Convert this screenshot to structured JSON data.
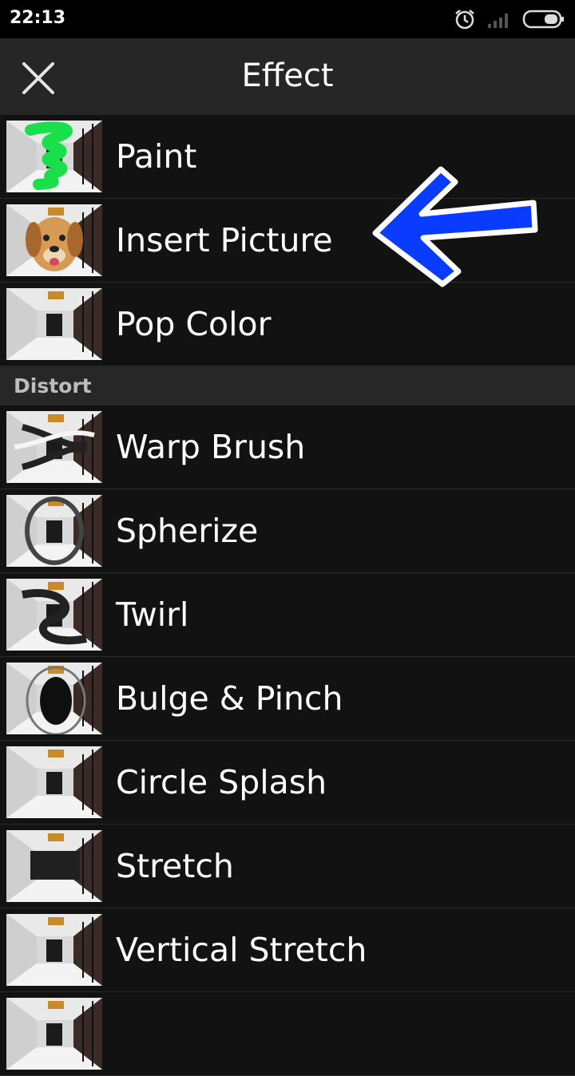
{
  "status_bar": {
    "time": "22:13",
    "icons": [
      "alarm-icon",
      "signal-icon",
      "battery-icon"
    ]
  },
  "app_bar": {
    "title": "Effect",
    "close_icon": "close-icon"
  },
  "effects": [
    {
      "label": "Paint",
      "thumb": "paint"
    },
    {
      "label": "Insert Picture",
      "thumb": "dog"
    },
    {
      "label": "Pop Color",
      "thumb": "hall"
    }
  ],
  "distort_section": {
    "header": "Distort",
    "items": [
      {
        "label": "Warp Brush",
        "thumb": "warp"
      },
      {
        "label": "Spherize",
        "thumb": "sphere"
      },
      {
        "label": "Twirl",
        "thumb": "twirl"
      },
      {
        "label": "Bulge & Pinch",
        "thumb": "bulge"
      },
      {
        "label": "Circle Splash",
        "thumb": "hall"
      },
      {
        "label": "Stretch",
        "thumb": "stretch"
      },
      {
        "label": "Vertical Stretch",
        "thumb": "hall"
      },
      {
        "label": "",
        "thumb": "hall"
      }
    ]
  },
  "annotation": {
    "arrow_color": "#0a3cff"
  }
}
